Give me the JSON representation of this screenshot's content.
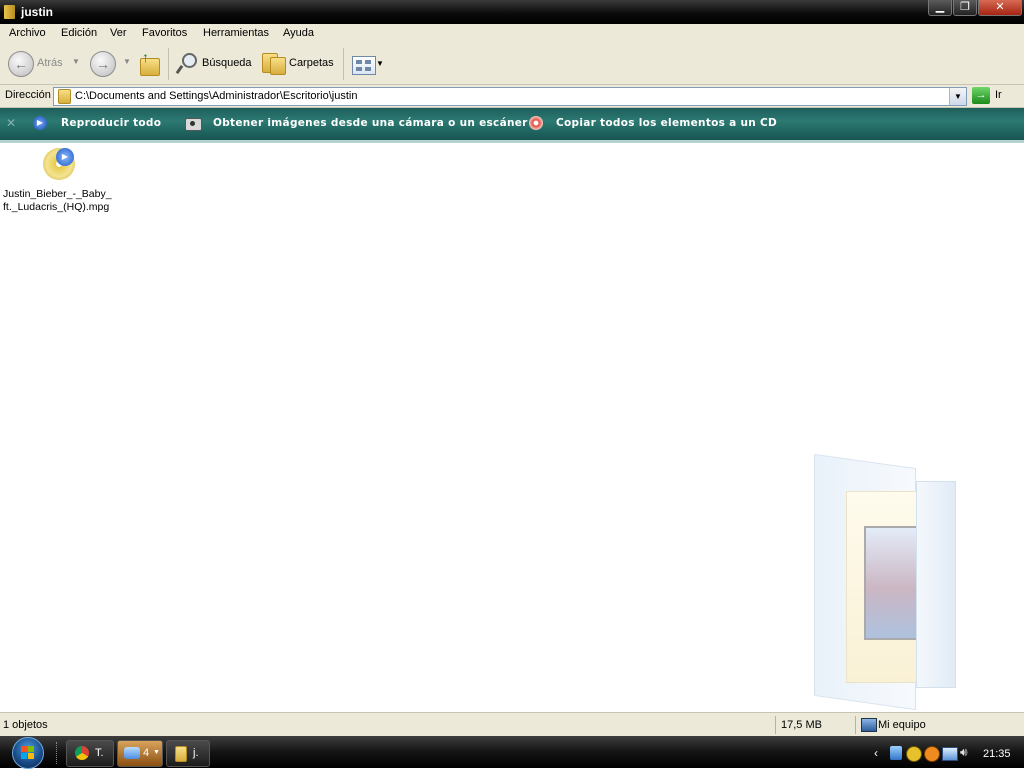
{
  "window": {
    "title": "justin"
  },
  "menu": [
    "Archivo",
    "Edición",
    "Ver",
    "Favoritos",
    "Herramientas",
    "Ayuda"
  ],
  "toolbar": {
    "back_label": "Atrás",
    "search_label": "Búsqueda",
    "folders_label": "Carpetas"
  },
  "address": {
    "label": "Dirección",
    "path": "C:\\Documents and Settings\\Administrador\\Escritorio\\justin",
    "go_label": "Ir"
  },
  "tasks": [
    "Reproducir todo",
    "Obtener imágenes desde una cámara o un escáner",
    "Copiar todos los elementos a un CD"
  ],
  "file": {
    "name_line1": "Justin_Bieber_-_Baby_",
    "name_line2": "ft._Ludacris_(HQ).mpg"
  },
  "status": {
    "count": "1 objetos",
    "size": "17,5 MB",
    "location": "Mi equipo"
  },
  "taskbar": {
    "btn1": "T.",
    "btn2": "4",
    "btn3": "j.",
    "clock": "21:35"
  }
}
